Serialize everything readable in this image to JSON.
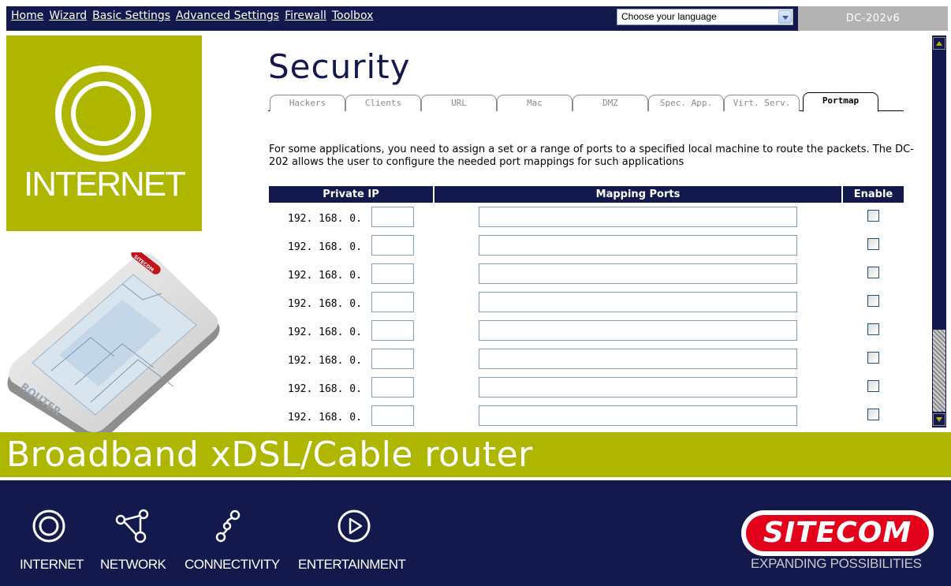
{
  "topnav": {
    "links": [
      "Home",
      "Wizard",
      "Basic Settings",
      "Advanced Settings",
      "Firewall",
      "Toolbox"
    ],
    "language_selected": "Choose your language",
    "model": "DC-202v6"
  },
  "side": {
    "tile_label": "INTERNET",
    "router_label": "ROUTER",
    "router_brand": "SITECOM"
  },
  "main": {
    "title": "Security",
    "tabs": [
      "Hackers",
      "Clients",
      "URL",
      "Mac",
      "DMZ",
      "Spec. App.",
      "Virt. Serv.",
      "Portmap"
    ],
    "active_tab": "Portmap",
    "description": "For some applications, you need to assign a set or a range of ports to a specified local machine to route the packets. The DC-202 allows the user to configure the needed port mappings for such applications",
    "columns": [
      "Private IP",
      "Mapping Ports",
      "Enable"
    ],
    "rows": [
      {
        "ip_prefix": "192. 168. 0.",
        "ip_last": "",
        "ports": "",
        "enabled": false
      },
      {
        "ip_prefix": "192. 168. 0.",
        "ip_last": "",
        "ports": "",
        "enabled": false
      },
      {
        "ip_prefix": "192. 168. 0.",
        "ip_last": "",
        "ports": "",
        "enabled": false
      },
      {
        "ip_prefix": "192. 168. 0.",
        "ip_last": "",
        "ports": "",
        "enabled": false
      },
      {
        "ip_prefix": "192. 168. 0.",
        "ip_last": "",
        "ports": "",
        "enabled": false
      },
      {
        "ip_prefix": "192. 168. 0.",
        "ip_last": "",
        "ports": "",
        "enabled": false
      },
      {
        "ip_prefix": "192. 168. 0.",
        "ip_last": "",
        "ports": "",
        "enabled": false
      },
      {
        "ip_prefix": "192. 168. 0.",
        "ip_last": "",
        "ports": "",
        "enabled": false
      }
    ]
  },
  "banner": {
    "text": "Broadband xDSL/Cable router"
  },
  "footer": {
    "items": [
      {
        "label": "INTERNET",
        "icon": "internet-icon"
      },
      {
        "label": "NETWORK",
        "icon": "network-icon"
      },
      {
        "label": "CONNECTIVITY",
        "icon": "connectivity-icon"
      },
      {
        "label": "ENTERTAINMENT",
        "icon": "entertainment-icon"
      }
    ],
    "logo": "SITECOM",
    "tagline": "EXPANDING POSSIBILITIES"
  },
  "colors": {
    "navy": "#13184d",
    "olive": "#afb600",
    "brand_red": "#e2001a",
    "model_grey": "#b3b3b3"
  }
}
